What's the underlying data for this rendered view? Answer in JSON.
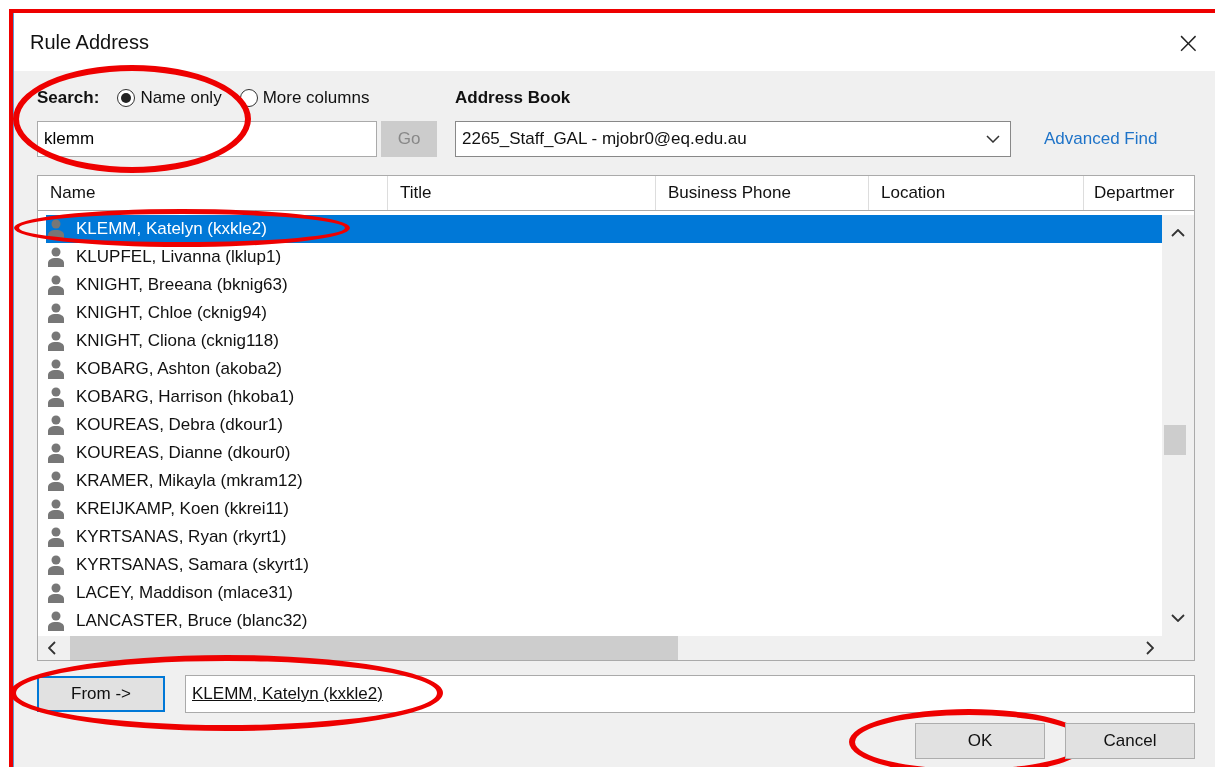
{
  "annotation_frame": true,
  "window": {
    "title": "Rule Address",
    "close": "×"
  },
  "search": {
    "label": "Search:",
    "circled": true,
    "options": [
      {
        "label": "Name only",
        "selected": true
      },
      {
        "label": "More columns",
        "selected": false
      }
    ],
    "value": "klemm",
    "go_button": {
      "label": "Go",
      "disabled": true
    }
  },
  "address_book": {
    "label": "Address Book",
    "value": "2265_Staff_GAL - mjobr0@eq.edu.au"
  },
  "advanced_find": "Advanced Find",
  "table": {
    "columns": [
      "Name",
      "Title",
      "Business Phone",
      "Location",
      "Departmer"
    ],
    "rows": [
      {
        "name": "KLEMM, Katelyn (kxkle2)",
        "selected": true,
        "circled": true
      },
      {
        "name": "KLUPFEL, Livanna (lklup1)",
        "selected": false,
        "circled": false
      },
      {
        "name": "KNIGHT, Breeana (bknig63)",
        "selected": false,
        "circled": false
      },
      {
        "name": "KNIGHT, Chloe (cknig94)",
        "selected": false,
        "circled": false
      },
      {
        "name": "KNIGHT, Cliona (cknig118)",
        "selected": false,
        "circled": false
      },
      {
        "name": "KOBARG, Ashton (akoba2)",
        "selected": false,
        "circled": false
      },
      {
        "name": "KOBARG, Harrison (hkoba1)",
        "selected": false,
        "circled": false
      },
      {
        "name": "KOUREAS, Debra (dkour1)",
        "selected": false,
        "circled": false
      },
      {
        "name": "KOUREAS, Dianne (dkour0)",
        "selected": false,
        "circled": false
      },
      {
        "name": "KRAMER, Mikayla (mkram12)",
        "selected": false,
        "circled": false
      },
      {
        "name": "KREIJKAMP, Koen (kkrei11)",
        "selected": false,
        "circled": false
      },
      {
        "name": "KYRTSANAS, Ryan (rkyrt1)",
        "selected": false,
        "circled": false
      },
      {
        "name": "KYRTSANAS, Samara (skyrt1)",
        "selected": false,
        "circled": false
      },
      {
        "name": "LACEY, Maddison (mlace31)",
        "selected": false,
        "circled": false
      },
      {
        "name": "LANCASTER, Bruce (blanc32)",
        "selected": false,
        "circled": false
      }
    ]
  },
  "from": {
    "button": "From ->",
    "value": "KLEMM, Katelyn (kxkle2)",
    "circled": true
  },
  "buttons": [
    {
      "label": "OK",
      "circled": true
    },
    {
      "label": "Cancel",
      "circled": false
    }
  ]
}
